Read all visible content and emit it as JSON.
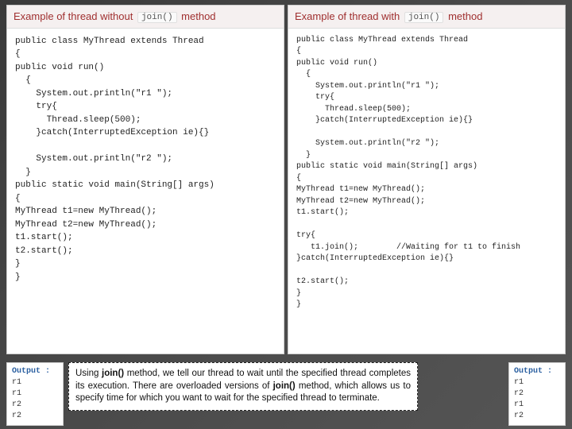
{
  "left": {
    "header_prefix": "Example of thread without",
    "header_chip": "join()",
    "header_suffix": "method",
    "code": "public class MyThread extends Thread\n{\npublic void run()\n  {\n    System.out.println(\"r1 \");\n    try{\n      Thread.sleep(500);\n    }catch(InterruptedException ie){}\n\n    System.out.println(\"r2 \");\n  }\npublic static void main(String[] args)\n{\nMyThread t1=new MyThread();\nMyThread t2=new MyThread();\nt1.start();\nt2.start();\n}\n}",
    "output_label": "Output :",
    "output": "r1\nr1\nr2\nr2"
  },
  "right": {
    "header_prefix": "Example of thread with",
    "header_chip": "join()",
    "header_suffix": "method",
    "code": "public class MyThread extends Thread\n{\npublic void run()\n  {\n    System.out.println(\"r1 \");\n    try{\n      Thread.sleep(500);\n    }catch(InterruptedException ie){}\n\n    System.out.println(\"r2 \");\n  }\npublic static void main(String[] args)\n{\nMyThread t1=new MyThread();\nMyThread t2=new MyThread();\nt1.start();\n\ntry{\n   t1.join();        //Waiting for t1 to finish\n}catch(InterruptedException ie){}\n\nt2.start();\n}\n}",
    "output_label": "Output :",
    "output": "r1\nr2\nr1\nr2"
  },
  "explain": "Using join() method, we tell our thread to wait until the specified thread completes its execution. There are overloaded versions of join() method, which allows us to specify time for which you want to wait for the specified thread to terminate."
}
